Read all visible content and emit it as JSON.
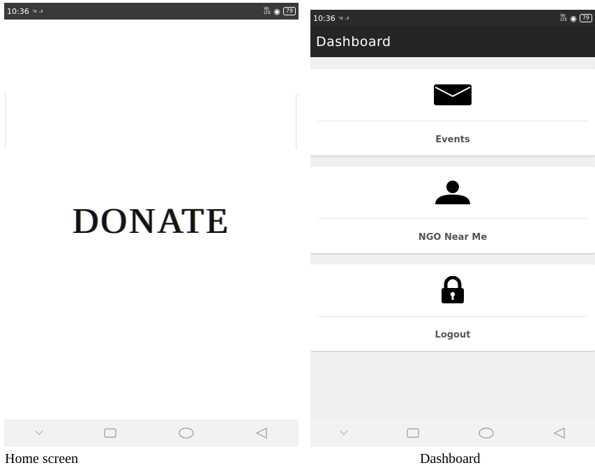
{
  "home": {
    "status_time": "10:36",
    "status_battery": "79",
    "donate_text": "DONATE",
    "caption": "Home screen"
  },
  "dashboard": {
    "status_time": "10:36",
    "status_battery": "79",
    "title": "Dashboard",
    "cards": [
      {
        "label": "Events",
        "icon": "envelope-icon"
      },
      {
        "label": "NGO Near Me",
        "icon": "person-icon"
      },
      {
        "label": "Logout",
        "icon": "lock-icon"
      }
    ],
    "caption": "Dashboard"
  },
  "colors": {
    "statusbar": "#3a3a3a",
    "appbar": "#252525",
    "dashboard_bg": "#f0f0f0",
    "label_text": "#555555"
  }
}
